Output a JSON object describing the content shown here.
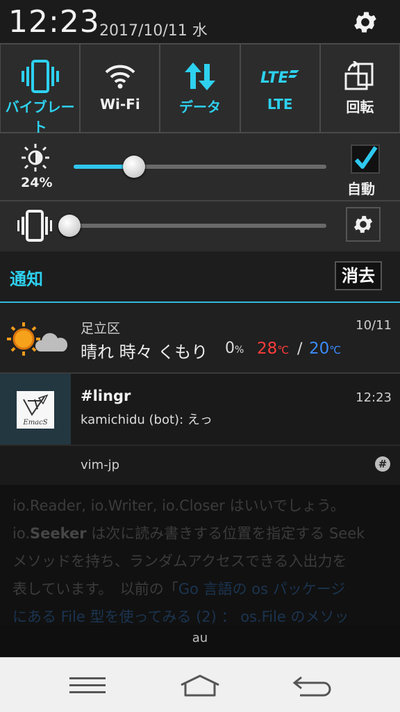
{
  "status": {
    "time": "12:23",
    "date": "2017/10/11 水"
  },
  "toggles": [
    {
      "label": "バイブレート",
      "icon": "vibrate-icon",
      "active": true,
      "color": "#2ed1ef"
    },
    {
      "label": "Wi-Fi",
      "icon": "wifi-icon",
      "active": false
    },
    {
      "label": "データ",
      "icon": "data-arrows-icon",
      "active": true,
      "color": "#2ed1ef"
    },
    {
      "label": "LTE",
      "icon": "lte-icon",
      "active": true,
      "color": "#2ed1ef"
    },
    {
      "label": "回転",
      "icon": "rotate-icon",
      "active": false
    }
  ],
  "brightness": {
    "percent": "24%",
    "value": 0.24,
    "auto_label": "自動",
    "auto_checked": true
  },
  "vibration_level": {
    "value": 0.0
  },
  "notifications": {
    "header": "通知",
    "clear": "消去",
    "weather": {
      "place": "足立区",
      "date": "10/11",
      "desc": "晴れ 時々 くもり",
      "rain": "0",
      "rain_unit": "%",
      "high": "28",
      "low": "20",
      "temp_unit": "℃",
      "slash": "/"
    },
    "lingr": {
      "title": "#lingr",
      "time": "12:23",
      "message": "kamichidu (bot): えっ",
      "app": "vim-jp",
      "icon_text": "EmacS"
    }
  },
  "background": {
    "line1": "io.Reader, io.Writer, io.Closer はいいでしょう。",
    "line2_bold": "Seeker",
    "line2_a": "io.",
    "line2_b": " は次に読み書きする位置を指定する Seek",
    "line3": "メソッドを持ち、ランダムアクセスできる入出力を",
    "line4_a": "表しています。　以前の「",
    "line4_link": "Go 言語の os パッケージ",
    "line5_link": "にある File 型を使ってみる (2) ： os.File のメソッ",
    "carrier": "au"
  },
  "nav": {
    "menu_icon": "menu-icon",
    "home_icon": "home-icon",
    "back_icon": "back-icon"
  }
}
